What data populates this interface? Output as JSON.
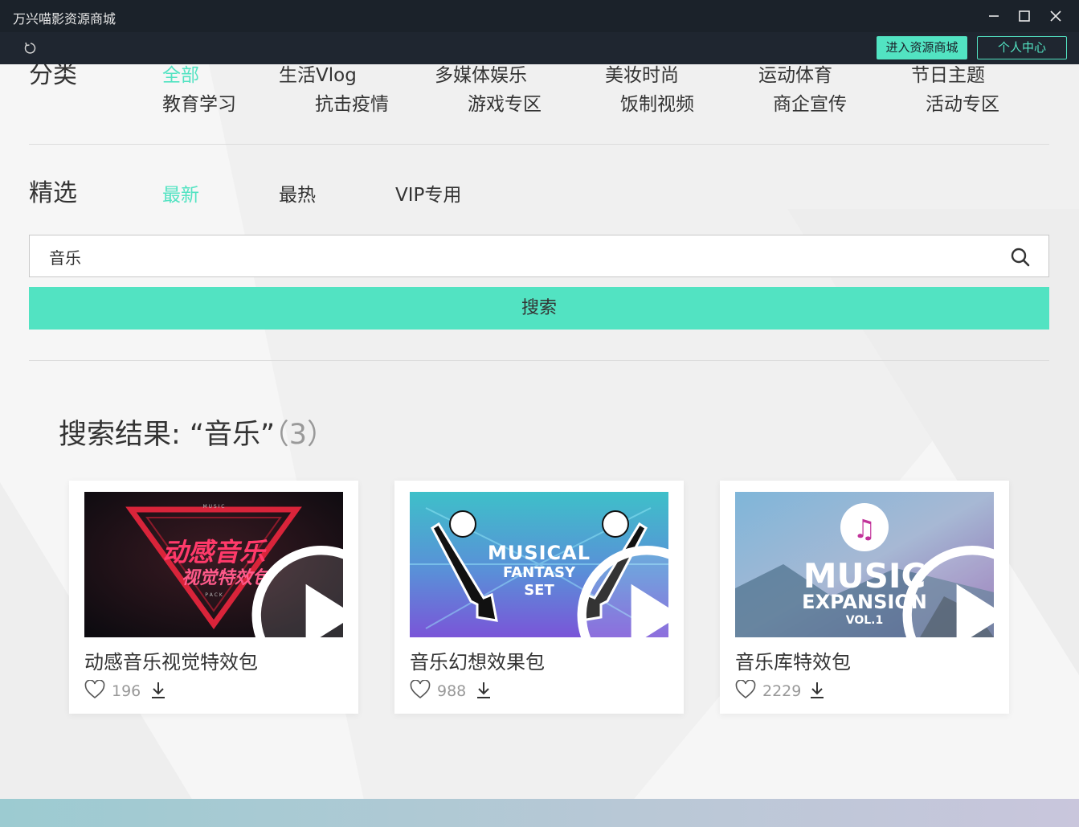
{
  "window": {
    "title": "万兴喵影资源商城"
  },
  "toolbar": {
    "store_button": "进入资源商城",
    "personal_button": "个人中心"
  },
  "categories": {
    "label": "分类",
    "items": [
      "全部",
      "生活Vlog",
      "多媒体娱乐",
      "美妆时尚",
      "运动体育",
      "节日主题",
      "教育学习",
      "抗击疫情",
      "游戏专区",
      "饭制视频",
      "商企宣传",
      "活动专区"
    ],
    "active_index": 0
  },
  "featured": {
    "label": "精选",
    "tabs": [
      "最新",
      "最热",
      "VIP专用"
    ],
    "active_index": 0
  },
  "search": {
    "value": "音乐",
    "button_label": "搜索"
  },
  "results": {
    "title": "搜索结果: “音乐”",
    "count": "（3）",
    "items": [
      {
        "title": "动感音乐视觉特效包",
        "likes": "196",
        "thumb_text_1": "动感音乐",
        "thumb_text_2": "视觉特效包",
        "thumb_small_1": "M U S I C",
        "thumb_small_2": "P A C K"
      },
      {
        "title": "音乐幻想效果包",
        "likes": "988",
        "thumb_text_1": "MUSICAL",
        "thumb_text_2": "FANTASY",
        "thumb_text_3": "SET"
      },
      {
        "title": "音乐库特效包",
        "likes": "2229",
        "thumb_text_1": "MUSIC",
        "thumb_text_2": "EXPANSION",
        "thumb_text_3": "VOL.1"
      }
    ]
  },
  "colors": {
    "accent": "#52e3c2",
    "titlebar": "#1b222a",
    "background": "#f6f6f6"
  }
}
